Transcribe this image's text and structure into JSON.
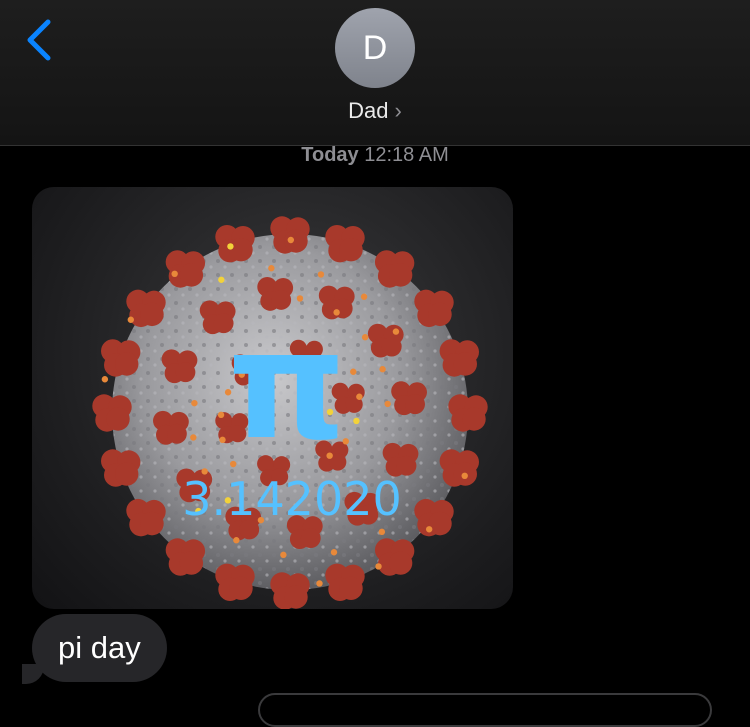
{
  "header": {
    "contact_initial": "D",
    "contact_name": "Dad",
    "chevron": "›"
  },
  "timestamp": {
    "day": "Today",
    "time": "12:18 AM"
  },
  "messages": {
    "image": {
      "pi_symbol": "π",
      "pi_text": "3.142020"
    },
    "text": "pi day"
  },
  "colors": {
    "accent": "#0a84ff",
    "pi_blue": "#55c1ff",
    "bubble_gray": "#262629",
    "spike_red": "#a8392b"
  }
}
